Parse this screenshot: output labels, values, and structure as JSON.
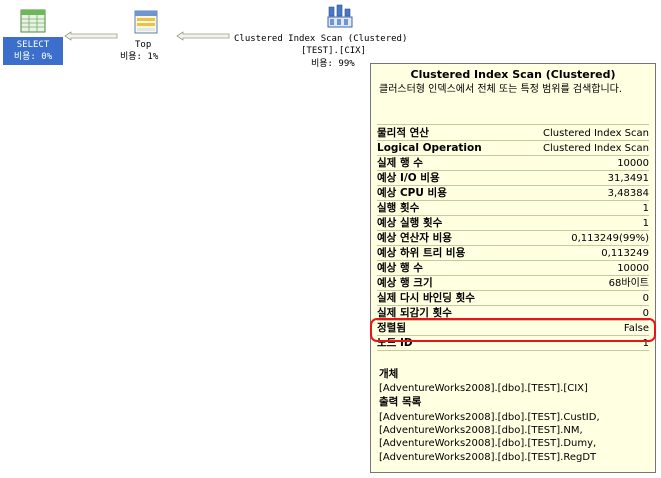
{
  "plan": {
    "select": {
      "label": "SELECT",
      "cost": "비용: 0%"
    },
    "top": {
      "label": "Top",
      "cost": "비용: 1%"
    },
    "scan": {
      "label": "Clustered Index Scan (Clustered)",
      "object": "[TEST].[CIX]",
      "cost": "비용: 99%"
    }
  },
  "tooltip": {
    "title": "Clustered Index Scan (Clustered)",
    "description": "클러스터형 인덱스에서 전체 또는 특정 범위를 검색합니다.",
    "properties": [
      {
        "key": "물리적 연산",
        "value": "Clustered Index Scan"
      },
      {
        "key": "Logical Operation",
        "value": "Clustered Index Scan"
      },
      {
        "key": "실제 행 수",
        "value": "10000"
      },
      {
        "key": "예상 I/O 비용",
        "value": "31,3491"
      },
      {
        "key": "예상 CPU 비용",
        "value": "3,48384"
      },
      {
        "key": "실행 횟수",
        "value": "1"
      },
      {
        "key": "예상 실행 횟수",
        "value": "1"
      },
      {
        "key": "예상 연산자 비용",
        "value": "0,113249(99%)"
      },
      {
        "key": "예상 하위 트리 비용",
        "value": "0,113249"
      },
      {
        "key": "예상 행 수",
        "value": "10000"
      },
      {
        "key": "예상 행 크기",
        "value": "68바이트"
      },
      {
        "key": "실제 다시 바인딩 횟수",
        "value": "0"
      },
      {
        "key": "실제 되감기 횟수",
        "value": "0"
      },
      {
        "key": "정렬됨",
        "value": "False"
      },
      {
        "key": "노드 ID",
        "value": "1"
      }
    ],
    "object_header": "개체",
    "object_value": "[AdventureWorks2008].[dbo].[TEST].[CIX]",
    "output_header": "출력 목록",
    "output_list": [
      "[AdventureWorks2008].[dbo].[TEST].CustID,",
      "[AdventureWorks2008].[dbo].[TEST].NM,",
      "[AdventureWorks2008].[dbo].[TEST].Dumy,",
      "[AdventureWorks2008].[dbo].[TEST].RegDT"
    ]
  },
  "colors": {
    "tooltip_bg": "#ffffe1",
    "selected_bg": "#3b6fcb",
    "highlight": "#e8141b"
  }
}
